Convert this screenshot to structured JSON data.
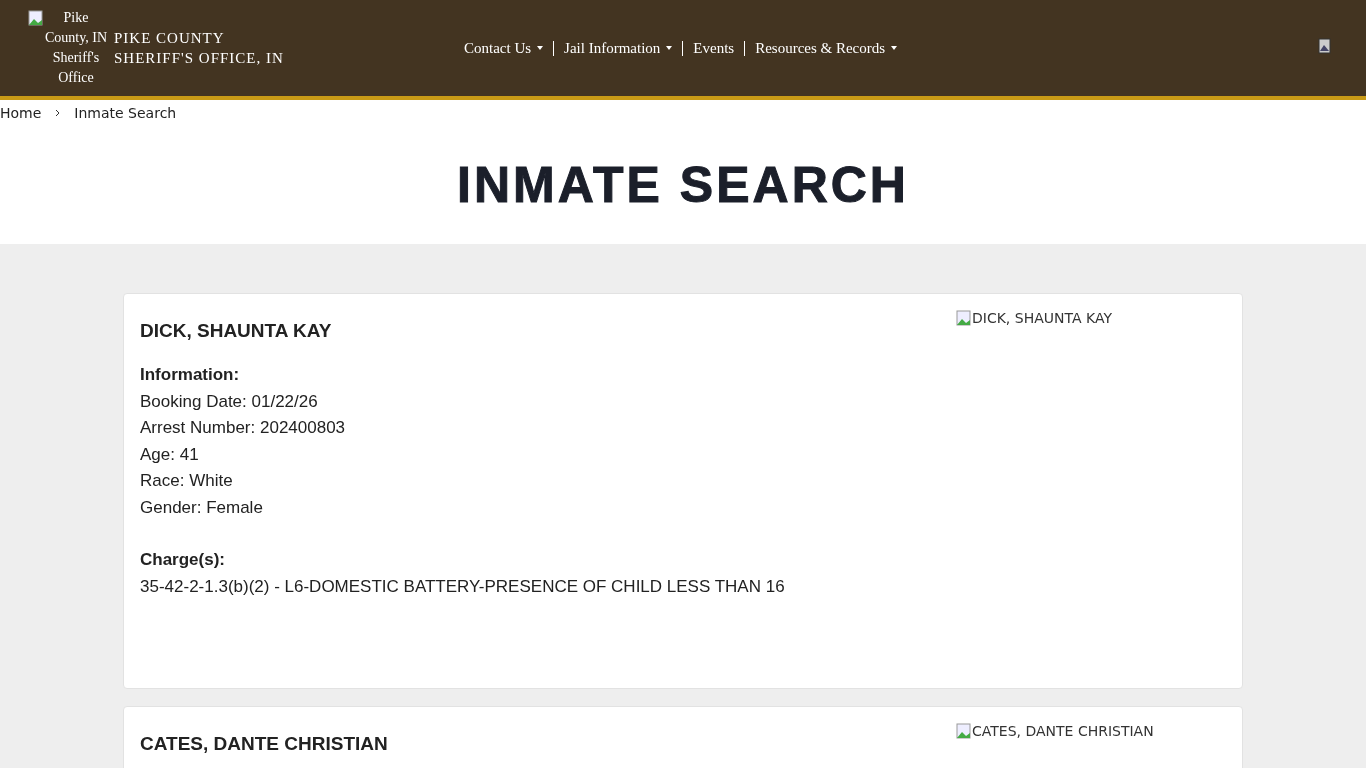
{
  "header": {
    "logo_alt": "Pike County, IN Sheriff's Office",
    "site_title": "PIKE COUNTY SHERIFF'S OFFICE, IN"
  },
  "nav": [
    {
      "label": "Contact Us",
      "has_dropdown": true
    },
    {
      "label": "Jail Information",
      "has_dropdown": true
    },
    {
      "label": "Events",
      "has_dropdown": false
    },
    {
      "label": "Resources & Records",
      "has_dropdown": true
    }
  ],
  "breadcrumb": [
    "Home",
    "Inmate Search"
  ],
  "page_title": "INMATE SEARCH",
  "inmates": [
    {
      "name": "DICK, SHAUNTA KAY",
      "photo_alt": "DICK, SHAUNTA KAY",
      "info_heading": "Information:",
      "fields": [
        "Booking Date: 01/22/26",
        "Arrest Number: 202400803",
        "Age: 41",
        "Race: White",
        "Gender: Female"
      ],
      "charges_heading": "Charge(s):",
      "charges": [
        "35-42-2-1.3(b)(2) - L6-DOMESTIC BATTERY-PRESENCE OF CHILD LESS THAN 16"
      ]
    },
    {
      "name": "CATES, DANTE CHRISTIAN",
      "photo_alt": "CATES, DANTE CHRISTIAN"
    }
  ]
}
